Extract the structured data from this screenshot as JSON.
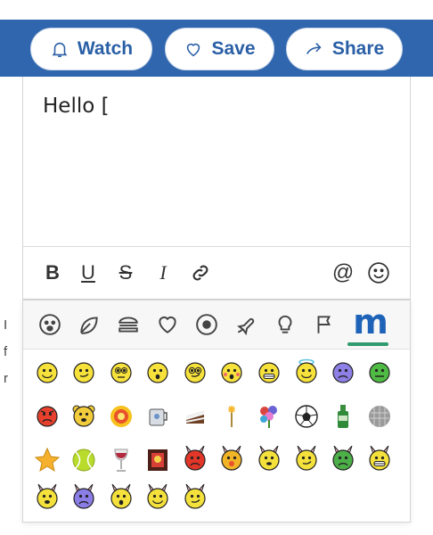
{
  "actions": {
    "watch_label": "Watch",
    "save_label": "Save",
    "share_label": "Share"
  },
  "editor": {
    "text": "Hello ["
  },
  "toolbar": {
    "bold": "B",
    "underline": "U",
    "strike": "S",
    "italic": "I",
    "mention": "@"
  },
  "picker": {
    "categories": [
      "smiley-face",
      "leaf",
      "burger",
      "heart",
      "soccer-ball",
      "airplane",
      "lightbulb",
      "flag",
      "m-custom"
    ],
    "active_category_label": "m",
    "emojis": [
      "yellow-smile",
      "yellow-smirk",
      "yellow-eyeroll",
      "yellow-surprised",
      "yellow-nerd",
      "yellow-blush",
      "yellow-grin",
      "yellow-angel",
      "purple-sad",
      "green-sick",
      "red-angry",
      "bear",
      "flower-face",
      "mug",
      "cake",
      "sparkler",
      "flowers",
      "soccer",
      "bottle",
      "disco-ball",
      "star",
      "tennis-ball",
      "wine-glass",
      "picture-frame",
      "bunny-red",
      "bunny-orange",
      "bunny-yellow",
      "bunny-nerd",
      "bunny-green",
      "bunny-grin",
      "bunny-yellow-2",
      "bunny-purple",
      "bunny-surprised",
      "bunny-smile",
      "bunny-smirk"
    ]
  }
}
